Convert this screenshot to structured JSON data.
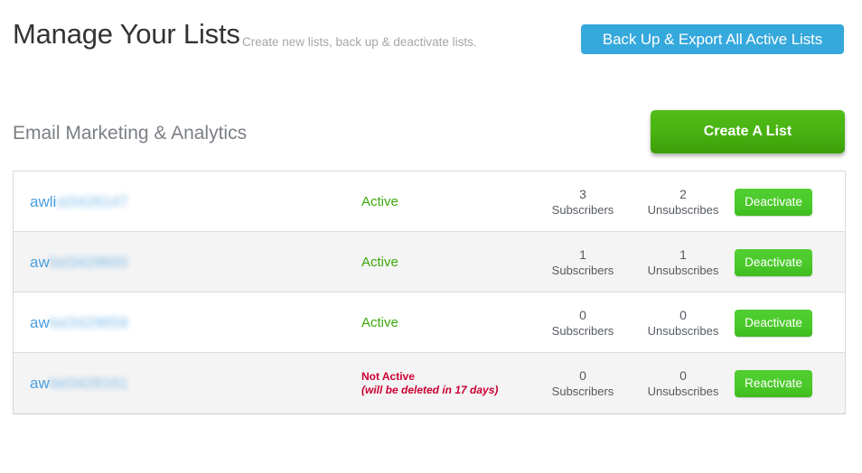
{
  "header": {
    "title": "Manage Your Lists",
    "subtitle": "Create new lists, back up & deactivate lists.",
    "backup_button_label": "Back Up & Export All Active Lists"
  },
  "section": {
    "title": "Email Marketing & Analytics",
    "create_button_label": "Create A List"
  },
  "colors": {
    "accent_blue": "#35a8dc",
    "accent_green": "#49b412",
    "button_green": "#4ac92a",
    "status_active_green": "#3ba80c",
    "status_inactive_red": "#cc0033",
    "link_blue": "#4a9fe0",
    "row_alt_background": "#f4f4f4",
    "table_border": "#d9d9d9"
  },
  "table": {
    "rows": [
      {
        "name_visible": "awli",
        "name_redacted": "st3428147",
        "status": "Active",
        "status_note": "",
        "subscribers_value": "3",
        "subscribers_label": "Subscribers",
        "unsubscribes_value": "2",
        "unsubscribes_label": "Unsubscribes",
        "action_label": "Deactivate"
      },
      {
        "name_visible": "aw",
        "name_redacted": "list3429655",
        "status": "Active",
        "status_note": "",
        "subscribers_value": "1",
        "subscribers_label": "Subscribers",
        "unsubscribes_value": "1",
        "unsubscribes_label": "Unsubscribes",
        "action_label": "Deactivate"
      },
      {
        "name_visible": "aw",
        "name_redacted": "list3429659",
        "status": "Active",
        "status_note": "",
        "subscribers_value": "0",
        "subscribers_label": "Subscribers",
        "unsubscribes_value": "0",
        "unsubscribes_label": "Unsubscribes",
        "action_label": "Deactivate"
      },
      {
        "name_visible": "aw",
        "name_redacted": "list3428161",
        "status": "Not Active",
        "status_note": "(will be deleted in 17 days)",
        "subscribers_value": "0",
        "subscribers_label": "Subscribers",
        "unsubscribes_value": "0",
        "unsubscribes_label": "Unsubscribes",
        "action_label": "Reactivate"
      }
    ]
  }
}
